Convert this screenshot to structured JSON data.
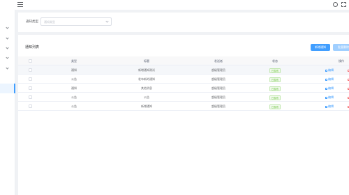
{
  "header": {
    "menu_icon": "hamburger-icon",
    "help_icon": "help-circle-icon",
    "fullscreen_icon": "fullscreen-icon"
  },
  "sidebar": {
    "items": [
      {
        "icon": "chevron-down-icon"
      },
      {
        "icon": "chevron-down-icon"
      },
      {
        "icon": "chevron-down-icon"
      },
      {
        "icon": "chevron-down-icon"
      },
      {
        "icon": "chevron-down-icon"
      },
      {
        "icon": "",
        "active": true
      }
    ]
  },
  "filter": {
    "label": "通知类型",
    "placeholder": "通知类型"
  },
  "list": {
    "title": "通知列表",
    "add_label": "新增通知",
    "delete_label": "批量删除",
    "columns": [
      "类型",
      "标题",
      "发送者",
      "状态",
      "操作"
    ],
    "rows": [
      {
        "type": "通知",
        "title": "新增通知测试",
        "sender": "超级管理员",
        "status": "已发布",
        "edit": "编辑",
        "del": "删"
      },
      {
        "type": "公告",
        "title": "发布新的通知",
        "sender": "超级管理员",
        "status": "已发布",
        "edit": "编辑",
        "del": "删"
      },
      {
        "type": "通知",
        "title": "其他消息",
        "sender": "超级管理员",
        "status": "已发布",
        "edit": "编辑",
        "del": "删"
      },
      {
        "type": "公告",
        "title": "公告",
        "sender": "超级管理员",
        "status": "已发布",
        "edit": "编辑",
        "del": "删"
      },
      {
        "type": "公告",
        "title": "新增通知",
        "sender": "超级管理员",
        "status": "已发布",
        "edit": "编辑",
        "del": "删"
      }
    ]
  },
  "colors": {
    "primary": "#409eff",
    "success": "#67c23a",
    "danger": "#f56c6c"
  }
}
